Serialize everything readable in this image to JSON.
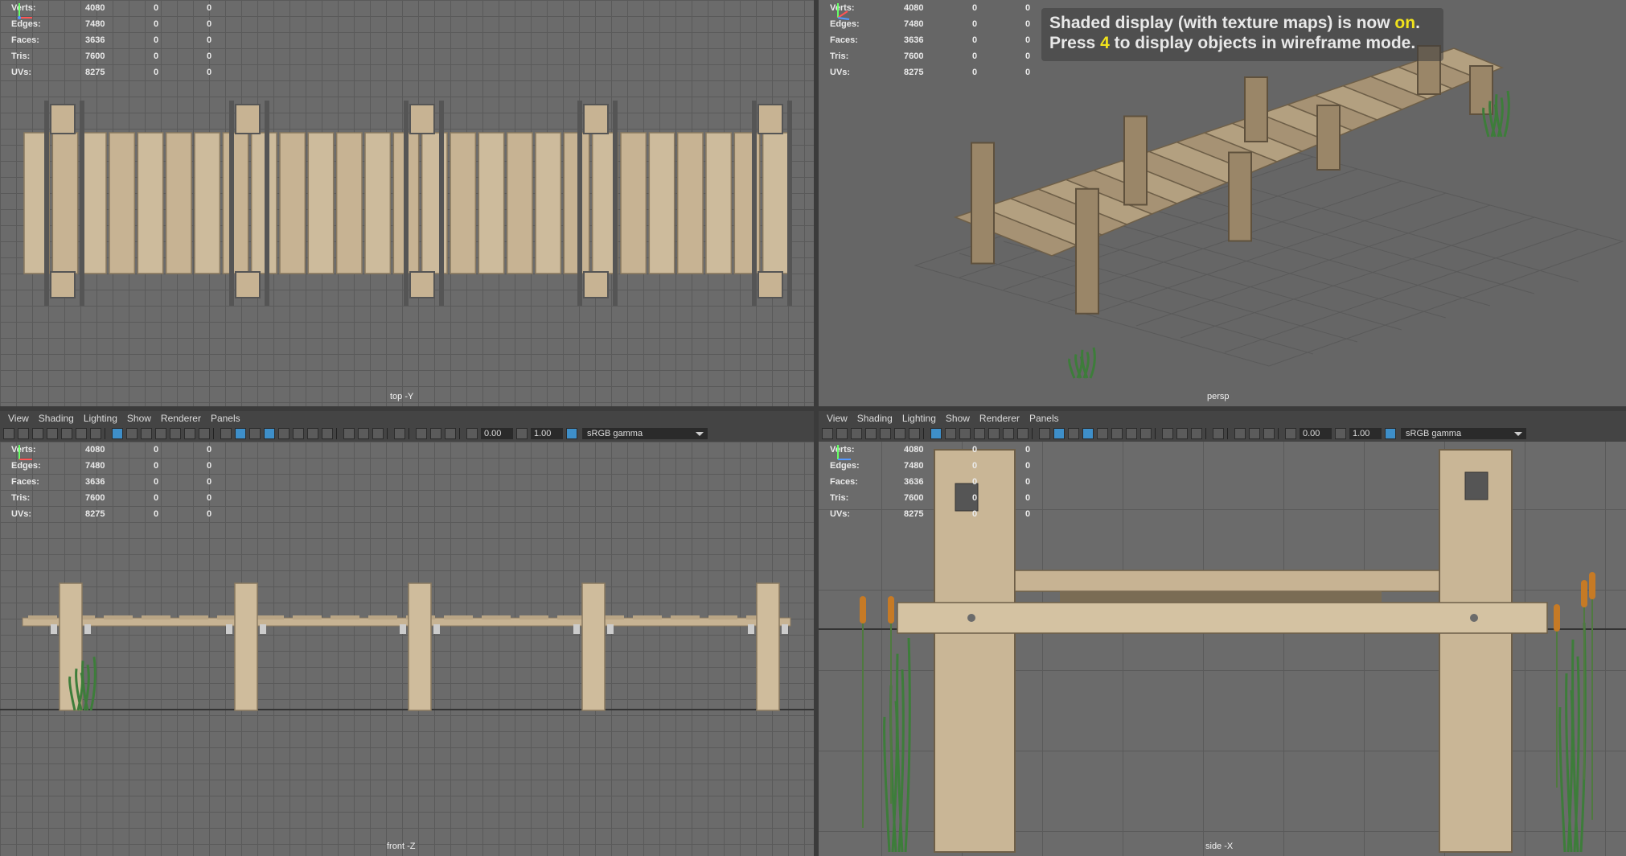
{
  "stats": [
    {
      "label": "Verts:",
      "value": "4080",
      "a": "0",
      "b": "0"
    },
    {
      "label": "Edges:",
      "value": "7480",
      "a": "0",
      "b": "0"
    },
    {
      "label": "Faces:",
      "value": "3636",
      "a": "0",
      "b": "0"
    },
    {
      "label": "Tris:",
      "value": "7600",
      "a": "0",
      "b": "0"
    },
    {
      "label": "UVs:",
      "value": "8275",
      "a": "0",
      "b": "0"
    }
  ],
  "cameras": {
    "top": "top -Y",
    "persp": "persp",
    "front": "front -Z",
    "side": "side -X"
  },
  "hud": {
    "line1_pre": "Shaded display (with texture maps) is now ",
    "line1_hl": "on",
    "line1_post": ".",
    "line2_pre": "Press ",
    "line2_hl": "4",
    "line2_post": " to display objects in wireframe mode."
  },
  "menu": [
    "View",
    "Shading",
    "Lighting",
    "Show",
    "Renderer",
    "Panels"
  ],
  "toolbar": {
    "exposure": "0.00",
    "gamma": "1.00",
    "colorspace": "sRGB gamma"
  },
  "colors": {
    "wood": "#c7b393",
    "wood_dark": "#8a7a60",
    "grass": "#3d7d3a",
    "cattail": "#c67a25",
    "hud_highlight": "#f0e21c"
  }
}
